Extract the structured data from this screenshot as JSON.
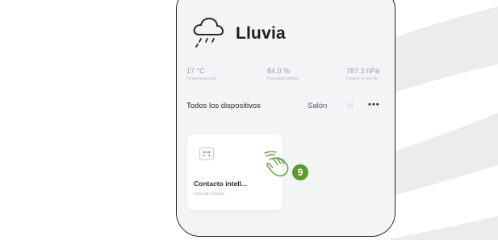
{
  "weather": {
    "icon": "rain-cloud-icon",
    "title": "Lluvia",
    "stats": [
      {
        "value": "17 °C",
        "label": "Temperatura ext."
      },
      {
        "value": "84.0 %",
        "label": "Humedad exterior"
      },
      {
        "value": "787.3 hPa",
        "label": "Presión al aire lib."
      }
    ]
  },
  "tabs": {
    "all": "Todos los dispositivos",
    "second": "Salón",
    "third": "M",
    "more": "•••"
  },
  "device": {
    "icon": "socket-icon",
    "name": "Contacto intell...",
    "room": "Sala de estudio"
  },
  "callout": {
    "step": "9",
    "icon": "tap-hand-icon",
    "color": "#5d9a2f"
  }
}
